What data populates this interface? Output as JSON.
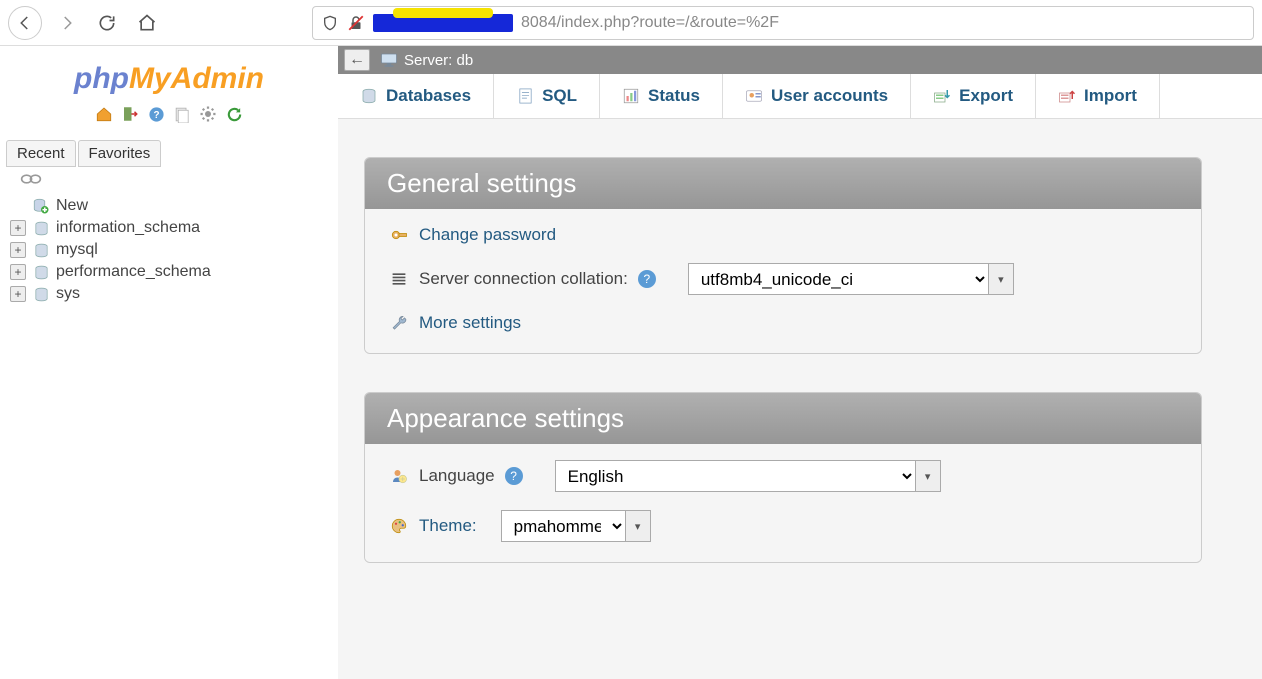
{
  "browser": {
    "url_suffix": "8084/index.php?route=/&route=%2F"
  },
  "sidebar": {
    "logo": {
      "php": "php",
      "my": "My",
      "admin": "Admin"
    },
    "tabs": {
      "recent": "Recent",
      "favorites": "Favorites"
    },
    "tree": [
      {
        "label": "New",
        "expandable": false,
        "new": true
      },
      {
        "label": "information_schema",
        "expandable": true
      },
      {
        "label": "mysql",
        "expandable": true
      },
      {
        "label": "performance_schema",
        "expandable": true
      },
      {
        "label": "sys",
        "expandable": true
      }
    ]
  },
  "server_bar": {
    "label": "Server: db"
  },
  "main_tabs": [
    {
      "label": "Databases"
    },
    {
      "label": "SQL"
    },
    {
      "label": "Status"
    },
    {
      "label": "User accounts"
    },
    {
      "label": "Export"
    },
    {
      "label": "Import"
    }
  ],
  "panels": {
    "general": {
      "title": "General settings",
      "change_password": "Change password",
      "collation_label": "Server connection collation:",
      "collation_value": "utf8mb4_unicode_ci",
      "more_settings": "More settings"
    },
    "appearance": {
      "title": "Appearance settings",
      "language_label": "Language",
      "language_value": "English",
      "theme_label": "Theme:",
      "theme_value": "pmahomme"
    }
  }
}
